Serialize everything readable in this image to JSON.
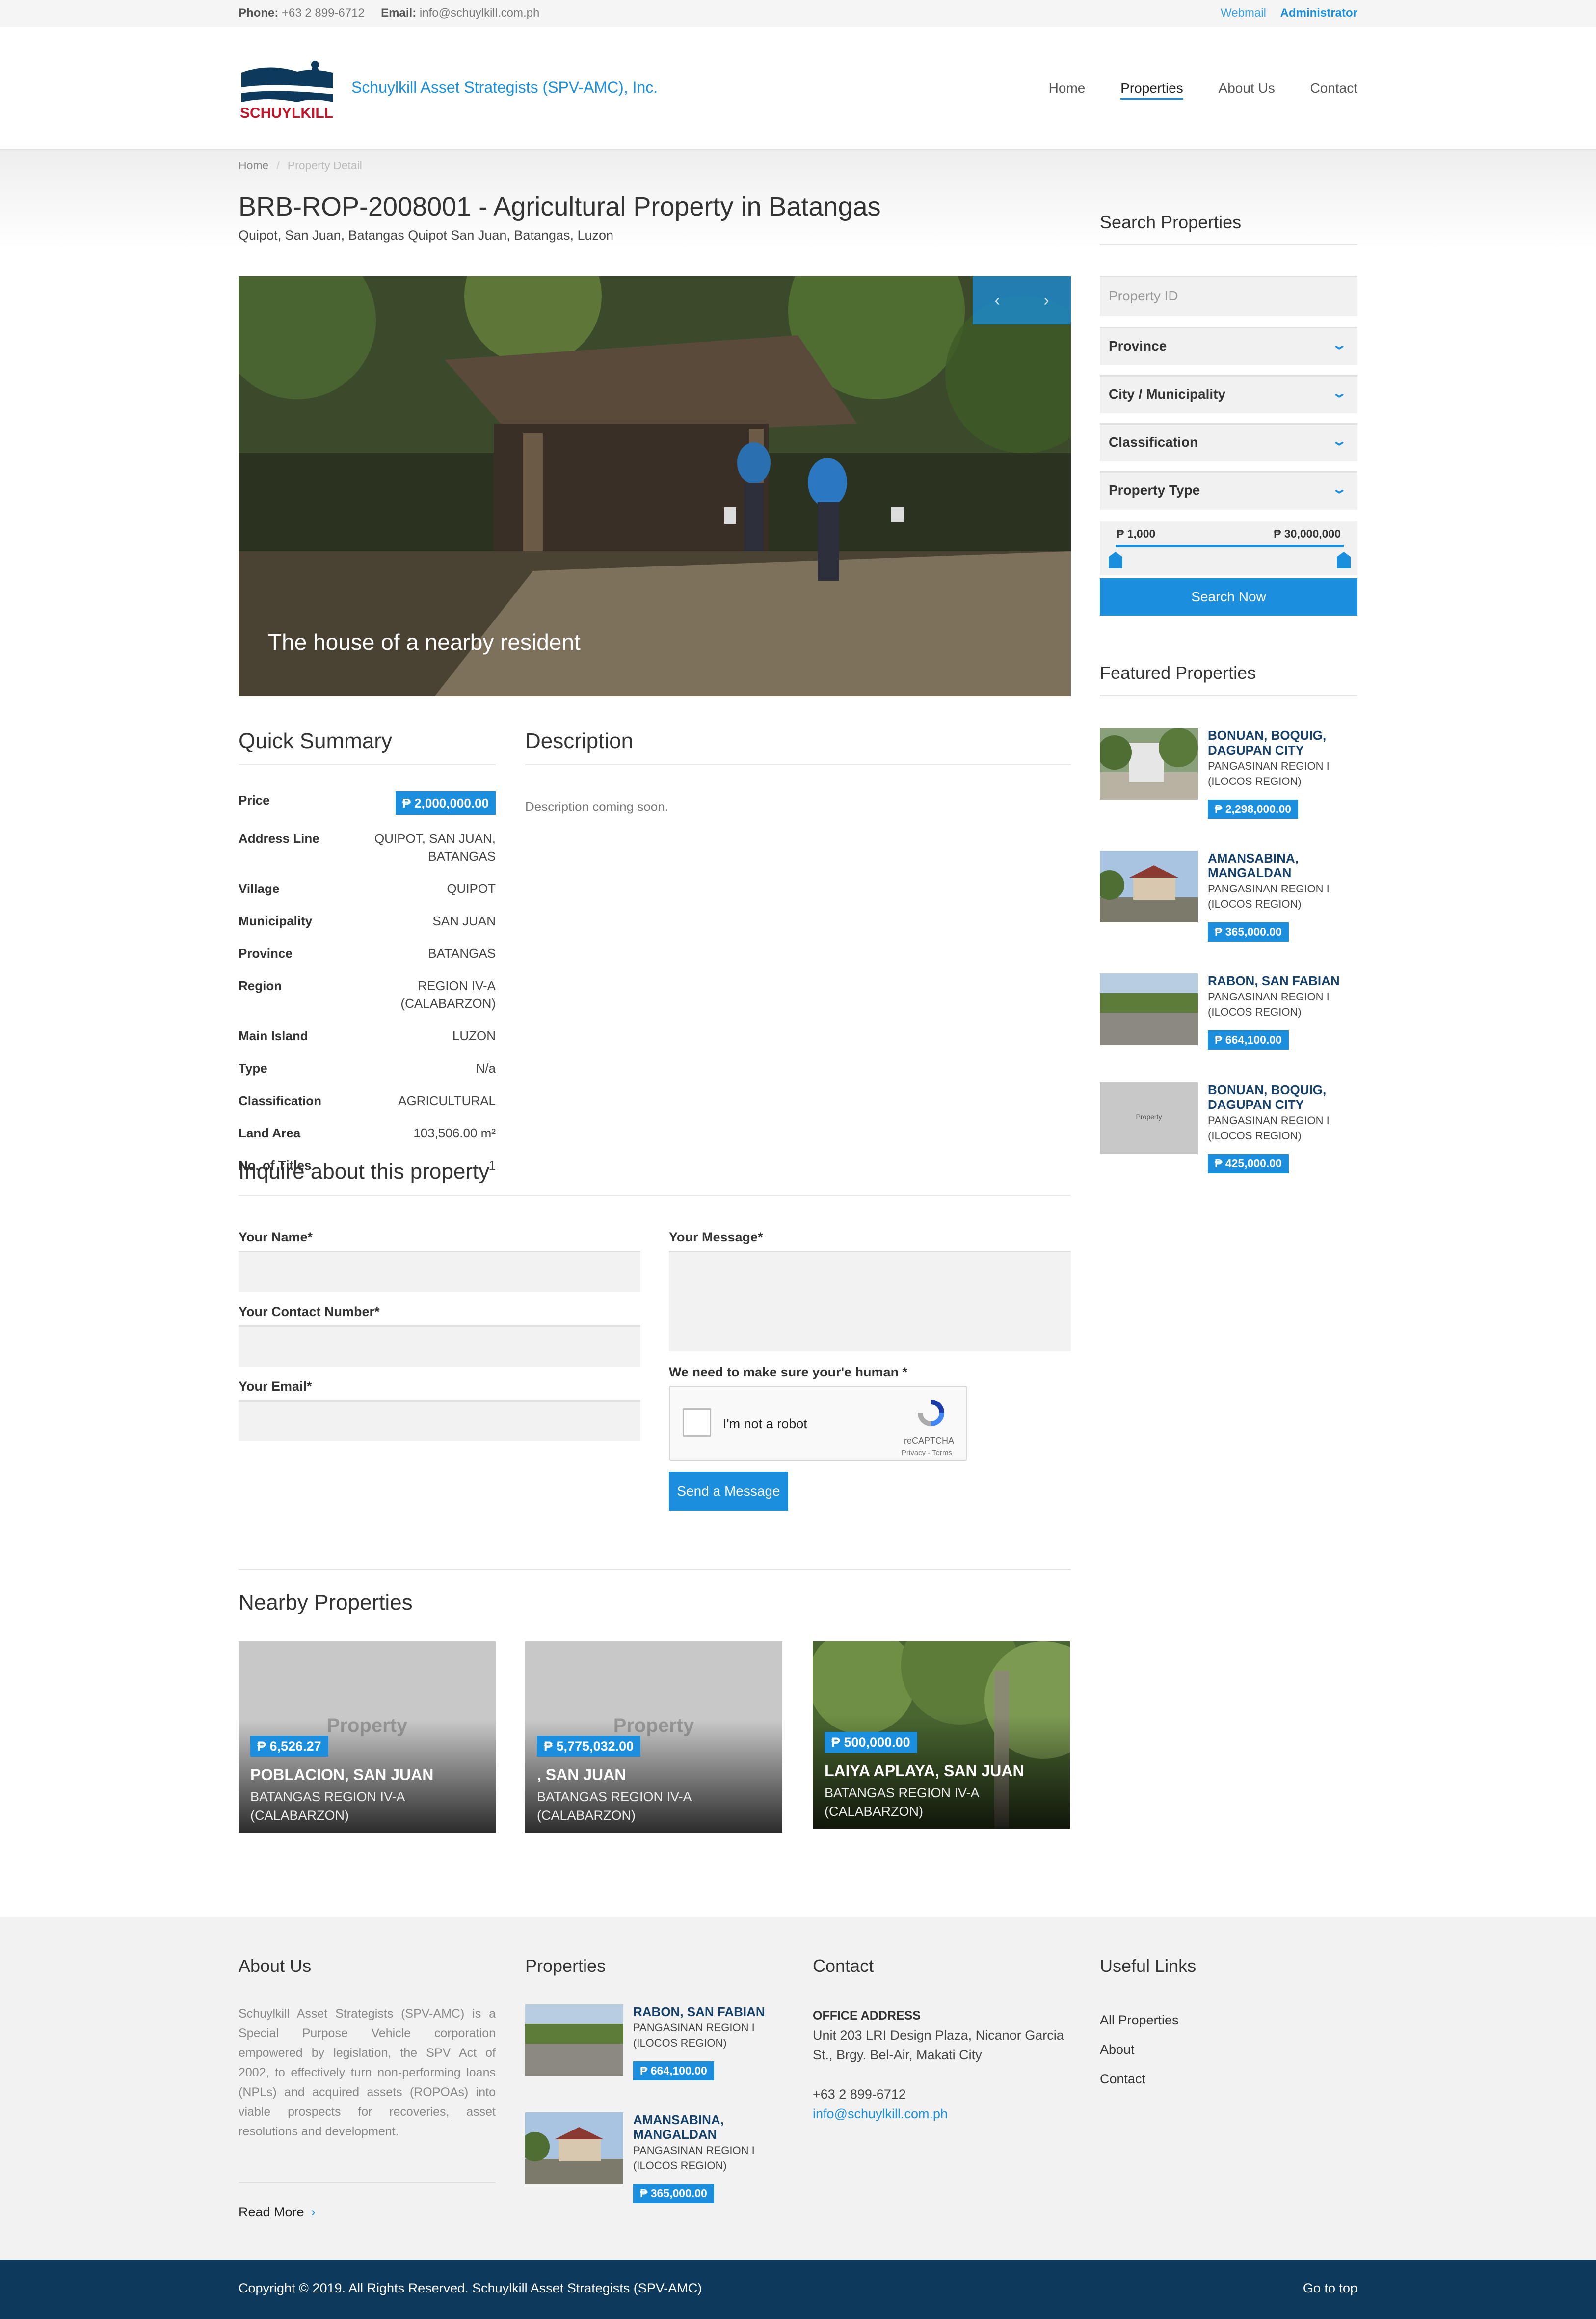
{
  "topbar": {
    "phone_label": "Phone:",
    "phone": "+63 2 899-6712",
    "email_label": "Email:",
    "email": "info@schuylkill.com.ph",
    "webmail": "Webmail",
    "admin": "Administrator"
  },
  "header": {
    "logo_text": "SCHUYLKILL",
    "brand": "Schuylkill Asset Strategists (SPV-AMC), Inc.",
    "nav": [
      "Home",
      "Properties",
      "About Us",
      "Contact"
    ],
    "active_nav": "Properties"
  },
  "breadcrumb": {
    "home": "Home",
    "current": "Property Detail"
  },
  "property": {
    "title": "BRB-ROP-2008001 - Agricultural Property in Batangas",
    "address": "Quipot, San Juan, Batangas Quipot San Juan, Batangas, Luzon",
    "hero_caption": "The house of a nearby resident",
    "prev": "‹",
    "next": "›"
  },
  "summary": {
    "title": "Quick Summary",
    "price_label": "Price",
    "price": "₱ 2,000,000.00",
    "rows": [
      {
        "k": "Address Line",
        "v": "QUIPOT, SAN JUAN, BATANGAS"
      },
      {
        "k": "Village",
        "v": "QUIPOT"
      },
      {
        "k": "Municipality",
        "v": "SAN JUAN"
      },
      {
        "k": "Province",
        "v": "BATANGAS"
      },
      {
        "k": "Region",
        "v": "REGION IV-A (CALABARZON)"
      },
      {
        "k": "Main Island",
        "v": "LUZON"
      },
      {
        "k": "Type",
        "v": "N/a"
      },
      {
        "k": "Classification",
        "v": "AGRICULTURAL"
      },
      {
        "k": "Land Area",
        "v": "103,506.00 m²"
      },
      {
        "k": "No. of Titles",
        "v": "1"
      }
    ]
  },
  "description": {
    "title": "Description",
    "text": "Description coming soon."
  },
  "inquire": {
    "title": "Inquire about this property",
    "name_label": "Your Name*",
    "contact_label": "Your Contact Number*",
    "email_label": "Your Email*",
    "message_label": "Your Message*",
    "human_label": "We need to make sure your'e human *",
    "captcha_text": "I'm not a robot",
    "captcha_brand": "reCAPTCHA",
    "captcha_links": "Privacy - Terms",
    "send": "Send a Message"
  },
  "nearby": {
    "title": "Nearby Properties",
    "placeholder": "Property",
    "items": [
      {
        "price": "₱ 6,526.27",
        "name": "POBLACION, SAN JUAN",
        "region1": "BATANGAS REGION IV-A",
        "region2": "(CALABARZON)"
      },
      {
        "price": "₱ 5,775,032.00",
        "name": ", SAN JUAN",
        "region1": "BATANGAS REGION IV-A",
        "region2": "(CALABARZON)"
      },
      {
        "price": "₱ 500,000.00",
        "name": "LAIYA APLAYA, SAN JUAN",
        "region1": "BATANGAS REGION IV-A",
        "region2": "(CALABARZON)"
      }
    ]
  },
  "search": {
    "title": "Search Properties",
    "property_id_placeholder": "Property ID",
    "province": "Province",
    "city": "City / Municipality",
    "classification": "Classification",
    "property_type": "Property Type",
    "min_price": "₱ 1,000",
    "max_price": "₱ 30,000,000",
    "button": "Search Now"
  },
  "featured": {
    "title": "Featured Properties",
    "items": [
      {
        "name1": "BONUAN, BOQUIG,",
        "name2": "DAGUPAN CITY",
        "region1": "PANGASINAN REGION I",
        "region2": "(ILOCOS REGION)",
        "price": "₱ 2,298,000.00"
      },
      {
        "name1": "AMANSABINA,",
        "name2": "MANGALDAN",
        "region1": "PANGASINAN REGION I",
        "region2": "(ILOCOS REGION)",
        "price": "₱ 365,000.00"
      },
      {
        "name1": "RABON, SAN FABIAN",
        "name2": "",
        "region1": "PANGASINAN REGION I",
        "region2": "(ILOCOS REGION)",
        "price": "₱ 664,100.00"
      },
      {
        "name1": "BONUAN, BOQUIG,",
        "name2": "DAGUPAN CITY",
        "region1": "PANGASINAN REGION I",
        "region2": "(ILOCOS REGION)",
        "price": "₱ 425,000.00",
        "placeholder": "Property"
      }
    ]
  },
  "footer": {
    "about_title": "About Us",
    "about_text": "Schuylkill Asset Strategists (SPV-AMC) is a Special Purpose Vehicle corporation empowered by legislation, the SPV Act of 2002, to effectively turn non-performing loans (NPLs) and acquired assets (ROPOAs) into viable prospects for recoveries, asset resolutions and development.",
    "read_more": "Read More",
    "properties_title": "Properties",
    "properties": [
      {
        "name1": "RABON, SAN FABIAN",
        "name2": "",
        "region1": "PANGASINAN REGION I",
        "region2": "(ILOCOS REGION)",
        "price": "₱ 664,100.00"
      },
      {
        "name1": "AMANSABINA,",
        "name2": "MANGALDAN",
        "region1": "PANGASINAN REGION I",
        "region2": "(ILOCOS REGION)",
        "price": "₱ 365,000.00"
      }
    ],
    "contact_title": "Contact",
    "office_label": "OFFICE ADDRESS",
    "address1": "Unit 203 LRI Design Plaza, Nicanor Garcia",
    "address2": "St., Brgy. Bel-Air, Makati City",
    "phone": "+63 2 899-6712",
    "email": "info@schuylkill.com.ph",
    "links_title": "Useful Links",
    "links": [
      "All Properties",
      "About",
      "Contact"
    ],
    "copyright": "Copyright © 2019. All Rights Reserved. Schuylkill Asset Strategists (SPV-AMC)",
    "go_top": "Go to top"
  },
  "colors": {
    "accent": "#1b8fde",
    "navy": "#0d3a5c",
    "logo_red": "#c0172b"
  }
}
